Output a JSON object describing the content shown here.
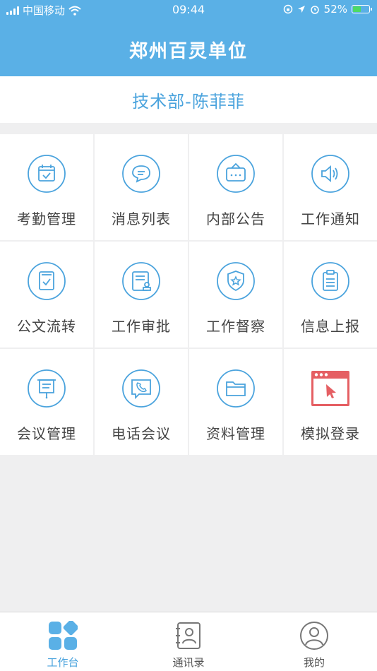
{
  "status_bar": {
    "carrier": "中国移动",
    "time": "09:44",
    "battery": "52%",
    "battery_level": 0.52
  },
  "header": {
    "title": "郑州百灵单位"
  },
  "department": {
    "name": "技术部-陈菲菲"
  },
  "colors": {
    "accent": "#5ab0e6",
    "icon_line": "#4aa3dd",
    "red_icon": "#e55f63"
  },
  "modules": [
    {
      "label": "考勤管理",
      "icon": "calendar-check-icon"
    },
    {
      "label": "消息列表",
      "icon": "chat-bubble-icon"
    },
    {
      "label": "内部公告",
      "icon": "bulletin-board-icon"
    },
    {
      "label": "工作通知",
      "icon": "speaker-icon"
    },
    {
      "label": "公文流转",
      "icon": "document-check-icon"
    },
    {
      "label": "工作审批",
      "icon": "approval-stamp-icon"
    },
    {
      "label": "工作督察",
      "icon": "shield-star-icon"
    },
    {
      "label": "信息上报",
      "icon": "clipboard-icon"
    },
    {
      "label": "会议管理",
      "icon": "presentation-board-icon"
    },
    {
      "label": "电话会议",
      "icon": "phone-chat-icon"
    },
    {
      "label": "资料管理",
      "icon": "folder-icon"
    },
    {
      "label": "模拟登录",
      "icon": "browser-cursor-icon"
    }
  ],
  "tabbar": {
    "tabs": [
      {
        "label": "工作台",
        "icon": "workbench-grid-icon",
        "active": true
      },
      {
        "label": "通讯录",
        "icon": "contacts-book-icon",
        "active": false
      },
      {
        "label": "我的",
        "icon": "user-profile-icon",
        "active": false
      }
    ]
  }
}
